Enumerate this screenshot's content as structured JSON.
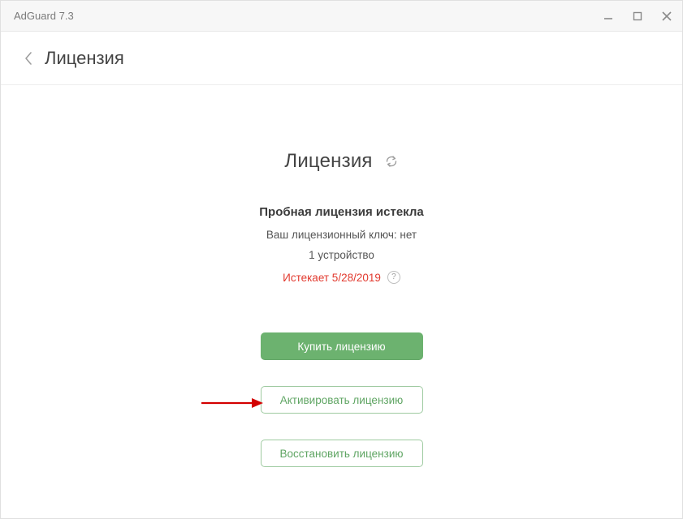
{
  "window": {
    "title": "AdGuard 7.3"
  },
  "header": {
    "page_title": "Лицензия"
  },
  "section": {
    "title": "Лицензия"
  },
  "status": {
    "headline": "Пробная лицензия истекла",
    "key_line": "Ваш лицензионный ключ: нет",
    "device_line": "1 устройство",
    "expiry": "Истекает 5/28/2019",
    "help_symbol": "?"
  },
  "buttons": {
    "buy": "Купить лицензию",
    "activate": "Активировать лицензию",
    "restore": "Восстановить лицензию"
  },
  "icons": {
    "minimize": "minimize-icon",
    "maximize": "maximize-icon",
    "close": "close-icon",
    "back": "chevron-left-icon",
    "refresh": "refresh-icon"
  }
}
